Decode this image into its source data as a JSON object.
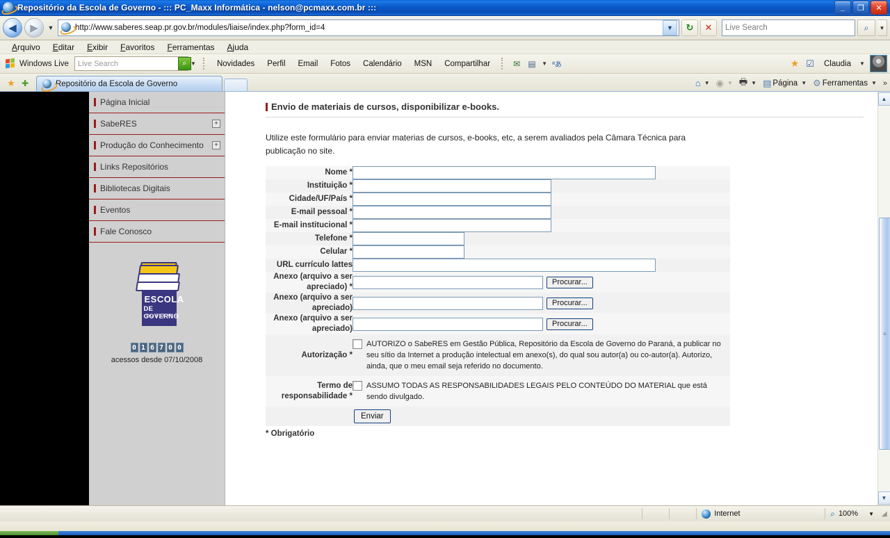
{
  "window": {
    "title": "Repositório da Escola de Governo - ::: PC_Maxx Informática  - nelson@pcmaxx.com.br :::",
    "minimize": "_",
    "maximize": "❐",
    "close": "✕"
  },
  "address_bar": {
    "back_icon": "◀",
    "forward_icon": "▶",
    "history_caret": "▼",
    "url": "http://www.saberes.seap.pr.gov.br/modules/liaise/index.php?form_id=4",
    "url_caret": "▼",
    "refresh_icon": "↻",
    "stop_icon": "✕",
    "search_placeholder": "Live Search",
    "search_value": "",
    "search_icon": "⌕",
    "search_caret": "▼"
  },
  "menu": {
    "items": [
      "Arquivo",
      "Editar",
      "Exibir",
      "Favoritos",
      "Ferramentas",
      "Ajuda"
    ]
  },
  "live_toolbar": {
    "brand": "Windows Live",
    "search_placeholder": "Live Search",
    "search_value": "",
    "go_icon": "⌕",
    "caret": "▼",
    "links": [
      "Novidades",
      "Perfil",
      "Email",
      "Fotos",
      "Calendário",
      "MSN",
      "Compartilhar"
    ],
    "icon_mail": "✉",
    "icon_window": "▤",
    "icon_window_caret": "▼",
    "icon_translate": "ªあ",
    "icon_star": "★",
    "icon_check": "☑",
    "user": "Claudia",
    "user_caret": "▼"
  },
  "tabs": {
    "favorites_star_icon": "★",
    "add_favorite_icon": "✚",
    "items": [
      {
        "label": "Repositório da Escola de Governo",
        "active": true
      }
    ]
  },
  "command_bar": {
    "home_icon": "⌂",
    "home_caret": "▼",
    "feeds_icon": "◉",
    "feeds_caret": "▼",
    "print_icon": "🖶",
    "print_caret": "▼",
    "page_icon": "▤",
    "page_label": "Página",
    "page_caret": "▼",
    "tools_icon": "⚙",
    "tools_label": "Ferramentas",
    "tools_caret": "▼",
    "overflow": "»"
  },
  "sidebar": {
    "items": [
      {
        "label": "Página Inicial",
        "expandable": false
      },
      {
        "label": "SabeRES",
        "expandable": true,
        "expand_icon": "+"
      },
      {
        "label": "Produção do Conhecimento",
        "expandable": true,
        "expand_icon": "+"
      },
      {
        "label": "Links Repositórios",
        "expandable": false
      },
      {
        "label": "Bibliotecas Digitais",
        "expandable": false
      },
      {
        "label": "Eventos",
        "expandable": false
      },
      {
        "label": "Fale Conosco",
        "expandable": false
      }
    ],
    "logo": {
      "line1": "ESCOLA",
      "line2": "DE GOVERNO",
      "line3": "DO PARANÁ"
    },
    "counter": {
      "digits": [
        "0",
        "1",
        "6",
        "7",
        "0",
        "0"
      ],
      "label": "acessos desde 07/10/2008"
    }
  },
  "page": {
    "title": "Envio de materiais de cursos, disponibilizar e-books.",
    "intro": "Utilize este formulário para enviar materias de cursos, e-books, etc, a serem avaliados pela Câmara Técnica para publicação no site.",
    "required_note": "* Obrigatório",
    "submit_label": "Enviar",
    "browse_label": "Procurar...",
    "fields": [
      {
        "label": "Nome *",
        "value": "",
        "size": "w-lg",
        "type": "text"
      },
      {
        "label": "Instituição *",
        "value": "",
        "size": "w-md",
        "type": "text"
      },
      {
        "label": "Cidade/UF/País *",
        "value": "",
        "size": "w-md",
        "type": "text"
      },
      {
        "label": "E-mail pessoal *",
        "value": "",
        "size": "w-md",
        "type": "text"
      },
      {
        "label": "E-mail institucional *",
        "value": "",
        "size": "w-md",
        "type": "text"
      },
      {
        "label": "Telefone *",
        "value": "",
        "size": "w-sm",
        "type": "text"
      },
      {
        "label": "Celular *",
        "value": "",
        "size": "w-sm",
        "type": "text"
      },
      {
        "label": "URL currículo lattes",
        "value": "",
        "size": "w-lg",
        "type": "text"
      },
      {
        "label": "Anexo (arquivo a ser apreciado) *",
        "value": "",
        "size": "w-file",
        "type": "file"
      },
      {
        "label": "Anexo (arquivo a ser apreciado)",
        "value": "",
        "size": "w-file",
        "type": "file"
      },
      {
        "label": "Anexo (arquivo a ser apreciado)",
        "value": "",
        "size": "w-file",
        "type": "file"
      }
    ],
    "checkboxes": [
      {
        "label": "Autorização *",
        "text": "AUTORIZO o SabeRES em Gestão Pública, Repositório da Escola de Governo do Paraná, a publicar no seu sítio da Internet a produção intelectual em anexo(s), do qual sou autor(a) ou co-autor(a). Autorizo, ainda, que o meu email seja referido no documento.",
        "checked": false
      },
      {
        "label": "Termo de responsabilidade *",
        "text": "ASSUMO TODAS AS RESPONSABILIDADES LEGAIS PELO CONTEÚDO DO MATERIAL que está sendo divulgado.",
        "checked": false
      }
    ]
  },
  "scrollbar": {
    "up_icon": "▲",
    "down_icon": "▼",
    "grip_icon": "≡",
    "thumb_top_pct": 29,
    "thumb_height_pct": 60
  },
  "status_bar": {
    "message": "",
    "zone": "Internet",
    "zoom": "100%",
    "zoom_caret": "▼",
    "zoom_icon": "⌕",
    "grip": "◢"
  },
  "colors": {
    "accent_red": "#9b1b1b",
    "titlebar_blue": "#0a58c8",
    "sidebar_gray": "#d0d0d0",
    "logo_purple": "#3b3680",
    "logo_yellow": "#f5c518",
    "counter_blue": "#4a6580"
  }
}
